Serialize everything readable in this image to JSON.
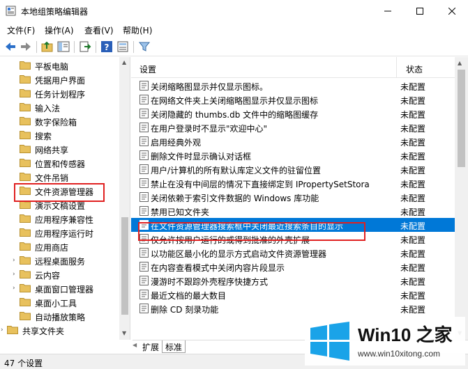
{
  "window": {
    "title": "本地组策略编辑器"
  },
  "menu": [
    "文件(F)",
    "操作(A)",
    "查看(V)",
    "帮助(H)"
  ],
  "tree": [
    {
      "label": "平板电脑",
      "expanded": false
    },
    {
      "label": "凭据用户界面",
      "expanded": false
    },
    {
      "label": "任务计划程序",
      "expanded": false
    },
    {
      "label": "输入法",
      "expanded": false
    },
    {
      "label": "数字保险箱",
      "expanded": false
    },
    {
      "label": "搜索",
      "expanded": false
    },
    {
      "label": "网络共享",
      "expanded": false
    },
    {
      "label": "位置和传感器",
      "expanded": false
    },
    {
      "label": "文件吊销",
      "expanded": false
    },
    {
      "label": "文件资源管理器",
      "expanded": false,
      "selected": true
    },
    {
      "label": "演示文稿设置",
      "expanded": false
    },
    {
      "label": "应用程序兼容性",
      "expanded": false
    },
    {
      "label": "应用程序运行时",
      "expanded": false
    },
    {
      "label": "应用商店",
      "expanded": false
    },
    {
      "label": "远程桌面服务",
      "expanded": false
    },
    {
      "label": "云内容",
      "expanded": false
    },
    {
      "label": "桌面窗口管理器",
      "expanded": false
    },
    {
      "label": "桌面小工具",
      "expanded": false
    },
    {
      "label": "自动播放策略",
      "expanded": false
    },
    {
      "label": "共享文件夹",
      "expanded": false
    }
  ],
  "columns": {
    "setting": "设置",
    "status": "状态"
  },
  "policies": [
    {
      "name": "关闭缩略图显示并仅显示图标。",
      "status": "未配置"
    },
    {
      "name": "在网络文件夹上关闭缩略图显示并仅显示图标",
      "status": "未配置"
    },
    {
      "name": "关闭隐藏的 thumbs.db 文件中的缩略图缓存",
      "status": "未配置"
    },
    {
      "name": "在用户登录时不显示\"欢迎中心\"",
      "status": "未配置"
    },
    {
      "name": "启用经典外观",
      "status": "未配置"
    },
    {
      "name": "删除文件时显示确认对话框",
      "status": "未配置"
    },
    {
      "name": "用户/计算机的所有默认库定义文件的驻留位置",
      "status": "未配置"
    },
    {
      "name": "禁止在没有中间层的情况下直接绑定到 IPropertySetStora",
      "status": "未配置"
    },
    {
      "name": "关闭依赖于索引文件数据的 Windows 库功能",
      "status": "未配置"
    },
    {
      "name": "禁用已知文件夹",
      "status": "未配置"
    },
    {
      "name": "在文件资源管理器搜索框中关闭最近搜索条目的显示",
      "status": "未配置",
      "selected": true
    },
    {
      "name": "仅允许按用户运行的或得到批准的外壳扩展",
      "status": "未配置"
    },
    {
      "name": "以功能区最小化的显示方式启动文件资源管理器",
      "status": "未配置"
    },
    {
      "name": "在内容查看模式中关闭内容片段显示",
      "status": "未配置"
    },
    {
      "name": "漫游时不跟踪外壳程序快捷方式",
      "status": "未配置"
    },
    {
      "name": "最近文档的最大数目",
      "status": "未配置"
    },
    {
      "name": "删除 CD 刻录功能",
      "status": "未配置"
    }
  ],
  "tabs": [
    "扩展",
    "标准"
  ],
  "statusbar": {
    "text": "47 个设置"
  },
  "watermark": {
    "name": "Win10 之家",
    "url": "www.win10xitong.com"
  },
  "colors": {
    "selection": "#0078d7",
    "highlight_box": "#e02020",
    "folder": "#e8c15d"
  }
}
